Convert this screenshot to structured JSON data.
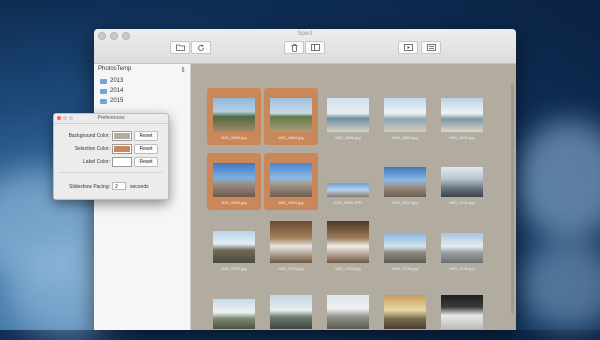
{
  "window": {
    "title": "Spect"
  },
  "toolbar": {
    "open_icon": "folder-icon",
    "refresh_icon": "refresh-icon",
    "trash_icon": "trash-icon",
    "sidebar_icon": "sidebar-icon",
    "slideshow_icon": "slideshow-icon",
    "prefs_icon": "preferences-icon"
  },
  "sidebar": {
    "source": "PhotosTemp",
    "folders": [
      "2013",
      "2014",
      "2015"
    ]
  },
  "photos": [
    {
      "name": "IMG_0683.jpg",
      "selected": true
    },
    {
      "name": "IMG_0684.jpg",
      "selected": true
    },
    {
      "name": "IMG_0686.jpg",
      "selected": false
    },
    {
      "name": "IMG_0689.jpg",
      "selected": false
    },
    {
      "name": "IMG_0690.jpg",
      "selected": false
    },
    {
      "name": "IMG_0693.jpg",
      "selected": true
    },
    {
      "name": "IMG_0694.jpg",
      "selected": true
    },
    {
      "name": "IMG_0695.JPG",
      "selected": false
    },
    {
      "name": "IMG_0697.jpg",
      "selected": false
    },
    {
      "name": "IMG_0701.jpg",
      "selected": false
    },
    {
      "name": "IMG_0702.jpg",
      "selected": false
    },
    {
      "name": "IMG_0703.jpg",
      "selected": false
    },
    {
      "name": "IMG_0704.jpg",
      "selected": false
    },
    {
      "name": "IMG_0705.jpg",
      "selected": false
    },
    {
      "name": "IMG_0706.jpg",
      "selected": false
    },
    {
      "name": "IMG_0707.JPG",
      "selected": false
    },
    {
      "name": "IMG_0708.jpg",
      "selected": false
    },
    {
      "name": "IMG_0709.jpg",
      "selected": false
    },
    {
      "name": "IMG_0711.jpg",
      "selected": false
    },
    {
      "name": "IMG_0712.jpg",
      "selected": false
    }
  ],
  "preferences": {
    "title": "Preferences",
    "background_label": "Background Color:",
    "selection_label": "Selection Color:",
    "label_color_label": "Label Color:",
    "reset_label": "Reset",
    "pacing_label": "Slideshow Pacing:",
    "pacing_value": "2",
    "pacing_unit": "seconds",
    "background_color": "#b2ab9f",
    "selection_color": "#ca875a",
    "label_color": "#ffffff"
  }
}
